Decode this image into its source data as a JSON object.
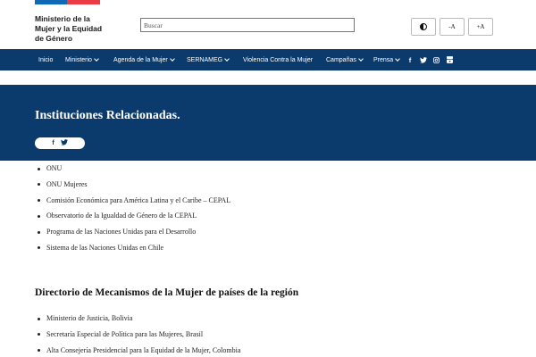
{
  "header": {
    "logo_lines": [
      "Ministerio de la",
      "Mujer y la Equidad",
      "de Género"
    ],
    "search_placeholder": "Buscar",
    "font_decrease_label": "-A",
    "font_increase_label": "+A",
    "flag_colors": {
      "blue": "#0f69b4",
      "red": "#eb3c46"
    }
  },
  "nav": {
    "items": [
      {
        "label": "Inicio",
        "has_dropdown": false
      },
      {
        "label": "Ministerio",
        "has_dropdown": true
      },
      {
        "label": "Agenda de la Mujer",
        "has_dropdown": true
      },
      {
        "label": "SERNAMEG",
        "has_dropdown": true
      },
      {
        "label": "Violencia Contra la Mujer",
        "has_dropdown": false
      },
      {
        "label": "Campañas",
        "has_dropdown": true
      },
      {
        "label": "Prensa",
        "has_dropdown": true
      }
    ],
    "social_icons": [
      "facebook-icon",
      "twitter-icon",
      "instagram-icon",
      "youtube-icon"
    ],
    "background_color": "#0b3a6d"
  },
  "hero": {
    "title": "Instituciones Relacionadas.",
    "share_icons": [
      "facebook-icon",
      "twitter-icon"
    ]
  },
  "related_institutions": [
    "ONU",
    "ONU Mujeres",
    "Comisión Económica para América Latina y el Caribe – CEPAL",
    "Observatorio de la Igualdad de Género de la CEPAL",
    "Programa de las Naciones Unidas para el Desarrollo",
    "Sistema de las Naciones Unidas en Chile"
  ],
  "directory": {
    "heading": "Directorio de Mecanismos de la Mujer de países de la región",
    "items": [
      "Ministerio de Justicia, Bolivia",
      "Secretaría Especial de Política para las Mujeres, Brasil",
      "Alta Consejería Presidencial para la Equidad de la Mujer, Colombia"
    ]
  }
}
